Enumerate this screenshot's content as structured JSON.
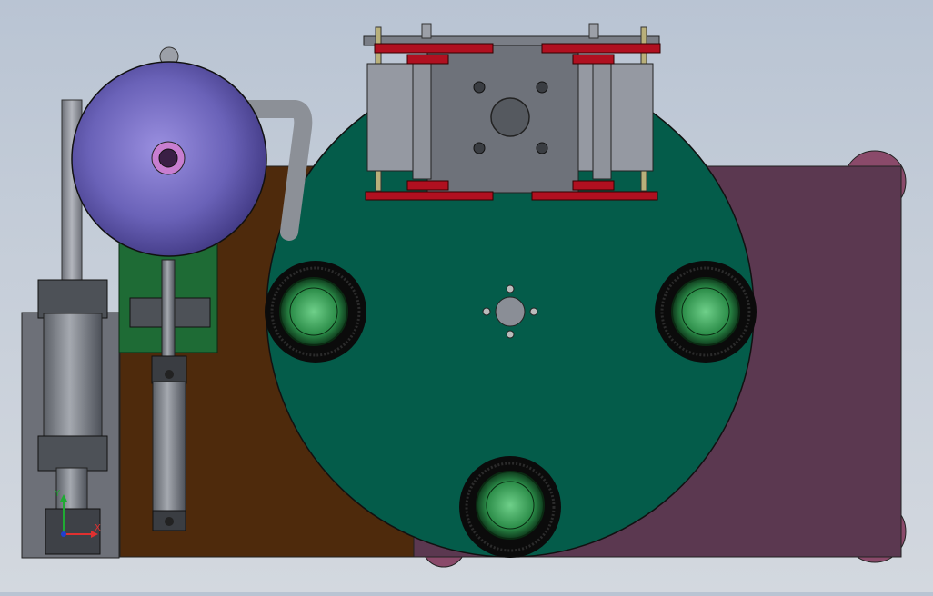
{
  "view": {
    "background_top": "#b9c4d3",
    "background_bottom": "#d3d8df"
  },
  "triad": {
    "x_label": "X",
    "y_label": "Y",
    "x_color": "#e03030",
    "y_color": "#1faa33",
    "z_color": "#2040d0"
  },
  "colors": {
    "base_brown": "#4e2a0c",
    "plate_mauve": "#5b3850",
    "turntable_green": "#045c4a",
    "hopper_purple": "#5a52a8",
    "pcb_green": "#1e6b35",
    "clamp_red": "#b01020",
    "steel_gray": "#8a8e96",
    "wheel_green": "#2e9a4e"
  },
  "components": {
    "turntable": "turntable",
    "hopper": "hopper",
    "feed_pipe": "feed-pipe",
    "press_head": "press-head",
    "left_cylinder": "pneumatic-cylinder-left",
    "small_cylinder": "pneumatic-cylinder-small",
    "stations": [
      "station-wheel-left",
      "station-wheel-right",
      "station-wheel-bottom"
    ]
  }
}
